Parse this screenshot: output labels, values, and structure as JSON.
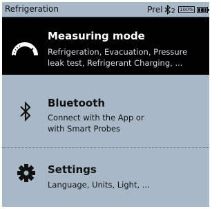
{
  "status_bar": {
    "title": "Refrigeration",
    "mode": "Prel",
    "bluetooth_channel": "2",
    "battery_percent": "100%",
    "icons": [
      "bluetooth-icon",
      "battery-icon"
    ]
  },
  "menu": {
    "items": [
      {
        "title": "Measuring mode",
        "description_lines": [
          "Refrigeration, Evacuation, Pressure",
          "leak test, Refrigerant Charging, ..."
        ],
        "icon": "gauge-icon",
        "selected": true
      },
      {
        "title": "Bluetooth",
        "description_lines": [
          "Connect with the App or",
          "with Smart Probes"
        ],
        "icon": "bluetooth-icon",
        "selected": false
      },
      {
        "title": "Settings",
        "description_lines": [
          "Language, Units, Light, ..."
        ],
        "icon": "gear-icon",
        "selected": false
      }
    ]
  },
  "colors": {
    "background": "#a8b8c6",
    "selected_background": "#000000",
    "text": "#111111",
    "selected_text": "#ffffff"
  }
}
